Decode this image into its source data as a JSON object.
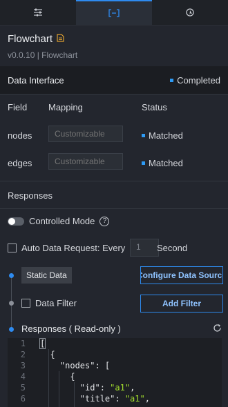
{
  "tabs": [
    {
      "name": "style",
      "icon": "sliders-icon"
    },
    {
      "name": "data",
      "icon": "data-bracket-icon",
      "active": true
    },
    {
      "name": "interaction",
      "icon": "interaction-icon"
    }
  ],
  "component": {
    "title": "Flowchart",
    "version": "v0.0.10 | Flowchart"
  },
  "data_interface": {
    "title": "Data Interface",
    "status": "Completed",
    "columns": {
      "field": "Field",
      "mapping": "Mapping",
      "status": "Status"
    },
    "rows": [
      {
        "field": "nodes",
        "placeholder": "Customizable",
        "status": "Matched"
      },
      {
        "field": "edges",
        "placeholder": "Customizable",
        "status": "Matched"
      }
    ]
  },
  "responses_section": {
    "title": "Responses",
    "controlled_mode": "Controlled Mode",
    "help": "?",
    "auto_request": "Auto Data Request: Every",
    "interval_value": "1",
    "interval_unit": "Second",
    "static_data": "Static Data",
    "configure_button": "Configure Data Source",
    "data_filter": "Data Filter",
    "add_filter_button": "Add Filter",
    "responses_readonly": "Responses ( Read-only )"
  },
  "code": {
    "line_numbers": [
      "1",
      "2",
      "3",
      "4",
      "5",
      "6"
    ],
    "lines": [
      [
        {
          "t": "[",
          "c": "punct"
        }
      ],
      [
        {
          "t": "  {",
          "c": "punct"
        }
      ],
      [
        {
          "t": "    \"nodes\"",
          "c": "str-key"
        },
        {
          "t": ": [",
          "c": "punct"
        }
      ],
      [
        {
          "t": "      {",
          "c": "punct"
        }
      ],
      [
        {
          "t": "        \"id\"",
          "c": "str-key"
        },
        {
          "t": ": ",
          "c": "punct"
        },
        {
          "t": "\"a1\"",
          "c": "str-val"
        },
        {
          "t": ",",
          "c": "punct"
        }
      ],
      [
        {
          "t": "        \"title\"",
          "c": "str-key"
        },
        {
          "t": ": ",
          "c": "punct"
        },
        {
          "t": "\"a1\"",
          "c": "str-val"
        },
        {
          "t": ",",
          "c": "punct"
        }
      ]
    ]
  },
  "colors": {
    "accent": "#2e8bf0",
    "success_string": "#a6e22e",
    "background": "#23262e"
  }
}
